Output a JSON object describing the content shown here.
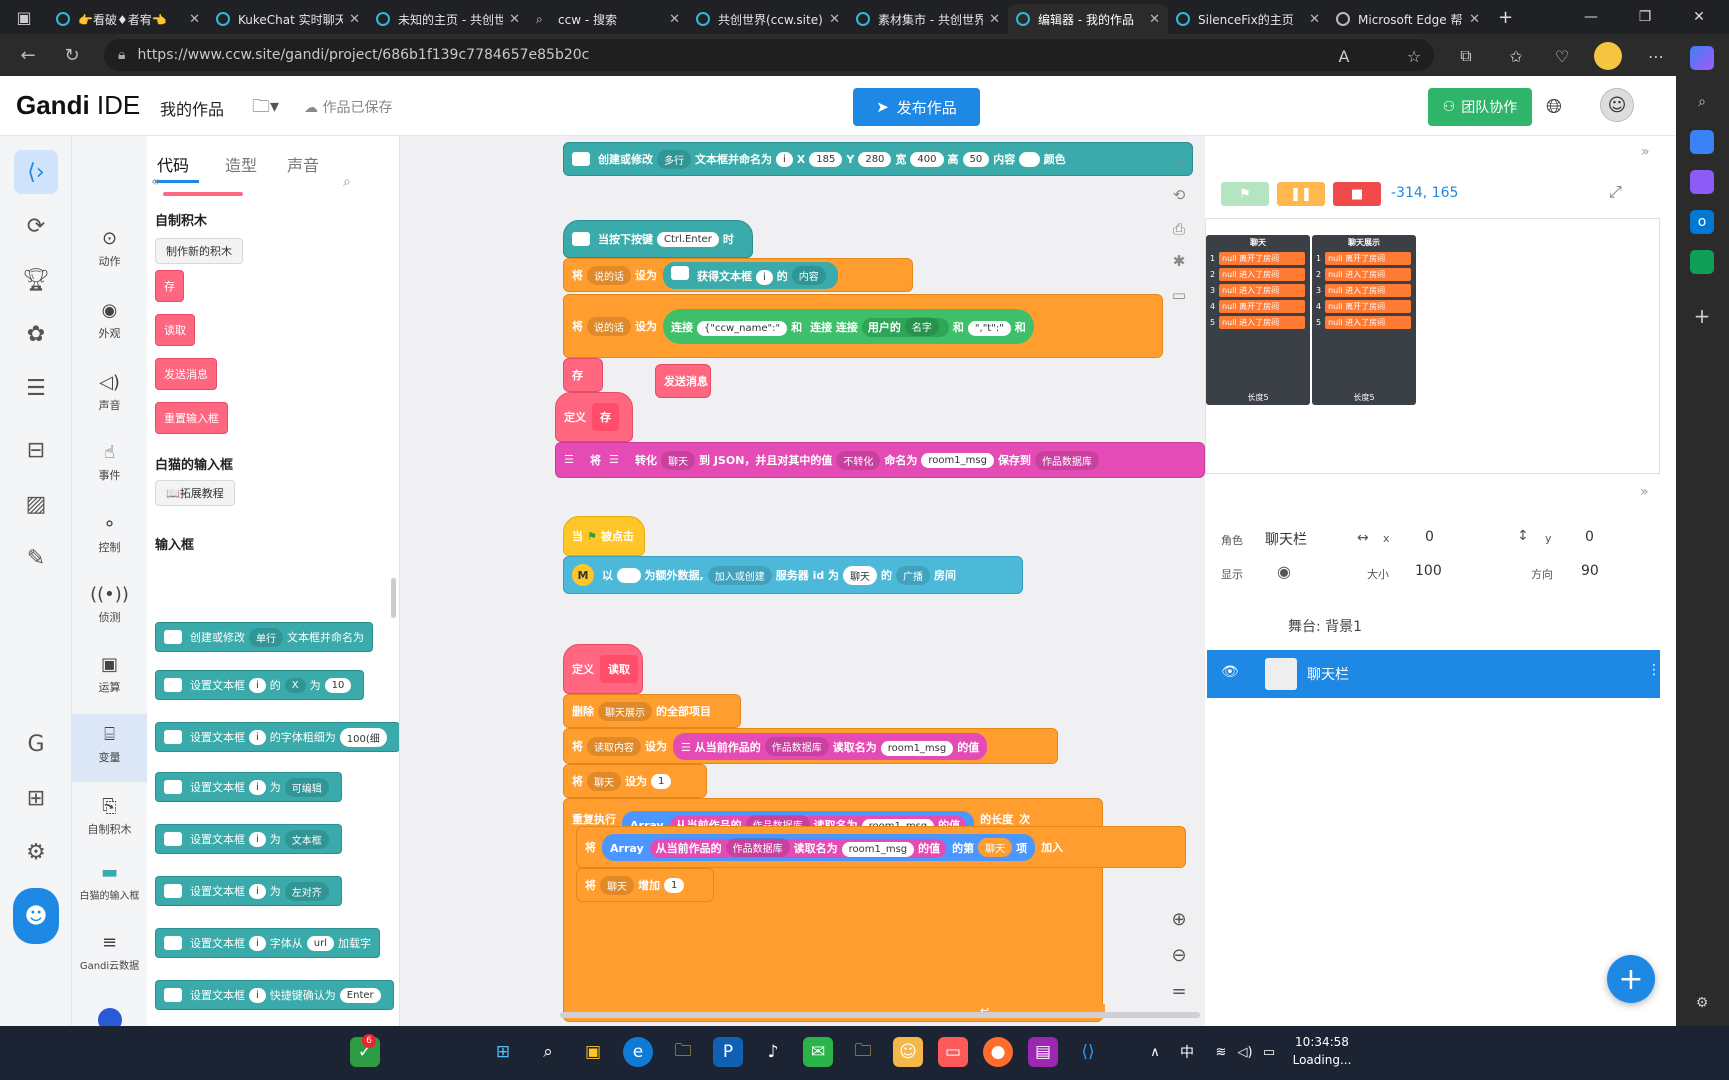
{
  "browser": {
    "tabs": [
      {
        "label": "👉看破♦者宥👈",
        "active": false
      },
      {
        "label": "KukeChat 实时聊天",
        "active": false
      },
      {
        "label": "未知的主页 - 共创世界",
        "active": false
      },
      {
        "label": "ccw - 搜索",
        "active": false
      },
      {
        "label": "共创世界(ccw.site)",
        "active": false
      },
      {
        "label": "素材集市 - 共创世界",
        "active": false
      },
      {
        "label": "编辑器 - 我的作品",
        "active": true
      },
      {
        "label": "SilenceFix的主页",
        "active": false
      },
      {
        "label": "Microsoft Edge 帮助",
        "active": false
      }
    ],
    "new_tab": "+",
    "url": "https://www.ccw.site/gandi/project/686b1f139c7784657e85b20c"
  },
  "ide": {
    "logo_bold": "Gandi",
    "logo_rest": " IDE",
    "my_works": "我的作品",
    "saved": "作品已保存",
    "publish": "发布作品",
    "team": "团队协作"
  },
  "palette": {
    "tabs": [
      "代码",
      "造型",
      "声音"
    ],
    "categories": [
      "动作",
      "外观",
      "声音",
      "事件",
      "控制",
      "侦测",
      "运算",
      "变量",
      "自制积木",
      "白猫的输入框",
      "Gandi云数据"
    ],
    "my_blocks_title": "自制积木",
    "make_block": "制作新的积木",
    "custom_blocks": [
      "存",
      "读取",
      "发送消息",
      "重置输入框"
    ],
    "ext_title": "白猫的输入框",
    "ext_tutorial": "📖拓展教程",
    "input_title": "输入框",
    "blocks": {
      "b1": {
        "a": "创建或修改",
        "dd": "单行",
        "b": "文本框并命名为"
      },
      "b2": {
        "a": "设置文本框",
        "p": "i",
        "b": "的",
        "dd": "X",
        "c": "为",
        "v": "10"
      },
      "b3": {
        "a": "设置文本框",
        "p": "i",
        "b": "的字体粗细为",
        "v": "100(细"
      },
      "b4": {
        "a": "设置文本框",
        "p": "i",
        "b": "为",
        "dd": "可编辑"
      },
      "b5": {
        "a": "设置文本框",
        "p": "i",
        "b": "为",
        "dd": "文本框"
      },
      "b6": {
        "a": "设置文本框",
        "p": "i",
        "b": "为",
        "dd": "左对齐"
      },
      "b7": {
        "a": "设置文本框",
        "p": "i",
        "b": "字体从",
        "v": "url",
        "c": "加载字"
      },
      "b8": {
        "a": "设置文本框",
        "p": "i",
        "b": "快捷键确认为",
        "v": "Enter"
      }
    }
  },
  "code": {
    "top": {
      "a": "创建或修改",
      "dd": "多行",
      "b": "文本框并命名为",
      "p": "i",
      "x": "X",
      "xv": "185",
      "y": "Y",
      "yv": "280",
      "w": "宽",
      "wv": "400",
      "h": "高",
      "hv": "50",
      "c": "内容",
      "col": "颜色"
    },
    "hat1": {
      "a": "当按下按键",
      "key": "Ctrl.Enter",
      "b": "时"
    },
    "set1": {
      "a": "将",
      "var": "说的话",
      "b": "设为",
      "c": "获得文本框",
      "p": "i",
      "d": "的",
      "dd": "内容"
    },
    "set2": {
      "a": "将",
      "var": "说的话",
      "b": "设为",
      "c": "连接",
      "s1": "{\"ccw_name\":\"",
      "and": "和",
      "c2": "连接",
      "c3": "连接",
      "user": "用户的",
      "dd": "名字",
      "and2": "和",
      "s2": "\",\"t\":\"",
      "and3": "和"
    },
    "call_save": "存",
    "loose_send": "发送消息",
    "def1": {
      "a": "定义",
      "name": "存"
    },
    "json1": {
      "a": "将",
      "b": "转化",
      "dd1": "聊天",
      "c": "到 JSON，并且对其中的值",
      "dd2": "不转化",
      "d": "命名为",
      "v": "room1_msg",
      "e": "保存到",
      "dd3": "作品数据库"
    },
    "flag": {
      "a": "当",
      "b": "被点击"
    },
    "join": {
      "a": "以",
      "b": "为额外数据,",
      "dd": "加入或创建",
      "c": "服务器 id 为",
      "v": "聊天",
      "d": "的",
      "dd2": "广播",
      "e": "房间"
    },
    "def2": {
      "a": "定义",
      "name": "读取"
    },
    "del": {
      "a": "删除",
      "dd": "聊天展示",
      "b": "的全部项目"
    },
    "set3": {
      "a": "将",
      "dd": "读取内容",
      "b": "设为",
      "c": "从当前作品的",
      "dd2": "作品数据库",
      "d": "读取名为",
      "v": "room1_msg",
      "e": "的值"
    },
    "set4": {
      "a": "将",
      "dd": "聊天",
      "b": "设为",
      "v": "1"
    },
    "rep": {
      "a": "重复执行",
      "arr": "Array",
      "c": "从当前作品的",
      "dd": "作品数据库",
      "d": "读取名为",
      "v": "room1_msg",
      "e": "的值",
      "f": "的长度",
      "g": "次"
    },
    "add": {
      "a": "将",
      "arr": "Array",
      "c": "从当前作品的",
      "dd": "作品数据库",
      "d": "读取名为",
      "v": "room1_msg",
      "e": "的值",
      "f": "的第",
      "v2": "聊天",
      "g": "项",
      "h": "加入"
    },
    "inc": {
      "a": "将",
      "dd": "聊天",
      "b": "增加",
      "v": "1"
    }
  },
  "stage": {
    "coords": "-314, 165",
    "list1": {
      "title": "聊天",
      "rows": [
        "null 离开了房间",
        "null 进入了房间",
        "null 进入了房间",
        "null 离开了房间",
        "null 进入了房间"
      ],
      "footer": "长度5"
    },
    "list2": {
      "title": "聊天展示",
      "rows": [
        "null 离开了房间",
        "null 进入了房间",
        "null 进入了房间",
        "null 离开了房间",
        "null 进入了房间"
      ],
      "footer": "长度5"
    }
  },
  "sprite_props": {
    "role_label": "角色",
    "role": "聊天栏",
    "x_label": "x",
    "x": "0",
    "y_label": "y",
    "y": "0",
    "show_label": "显示",
    "size_label": "大小",
    "size": "100",
    "dir_label": "方向",
    "dir": "90",
    "stage_bg": "舞台: 背景1",
    "sprite_name": "聊天栏"
  },
  "taskbar": {
    "time": "10:34:58",
    "status": "Loading...",
    "ime": "中",
    "badge": "6"
  }
}
